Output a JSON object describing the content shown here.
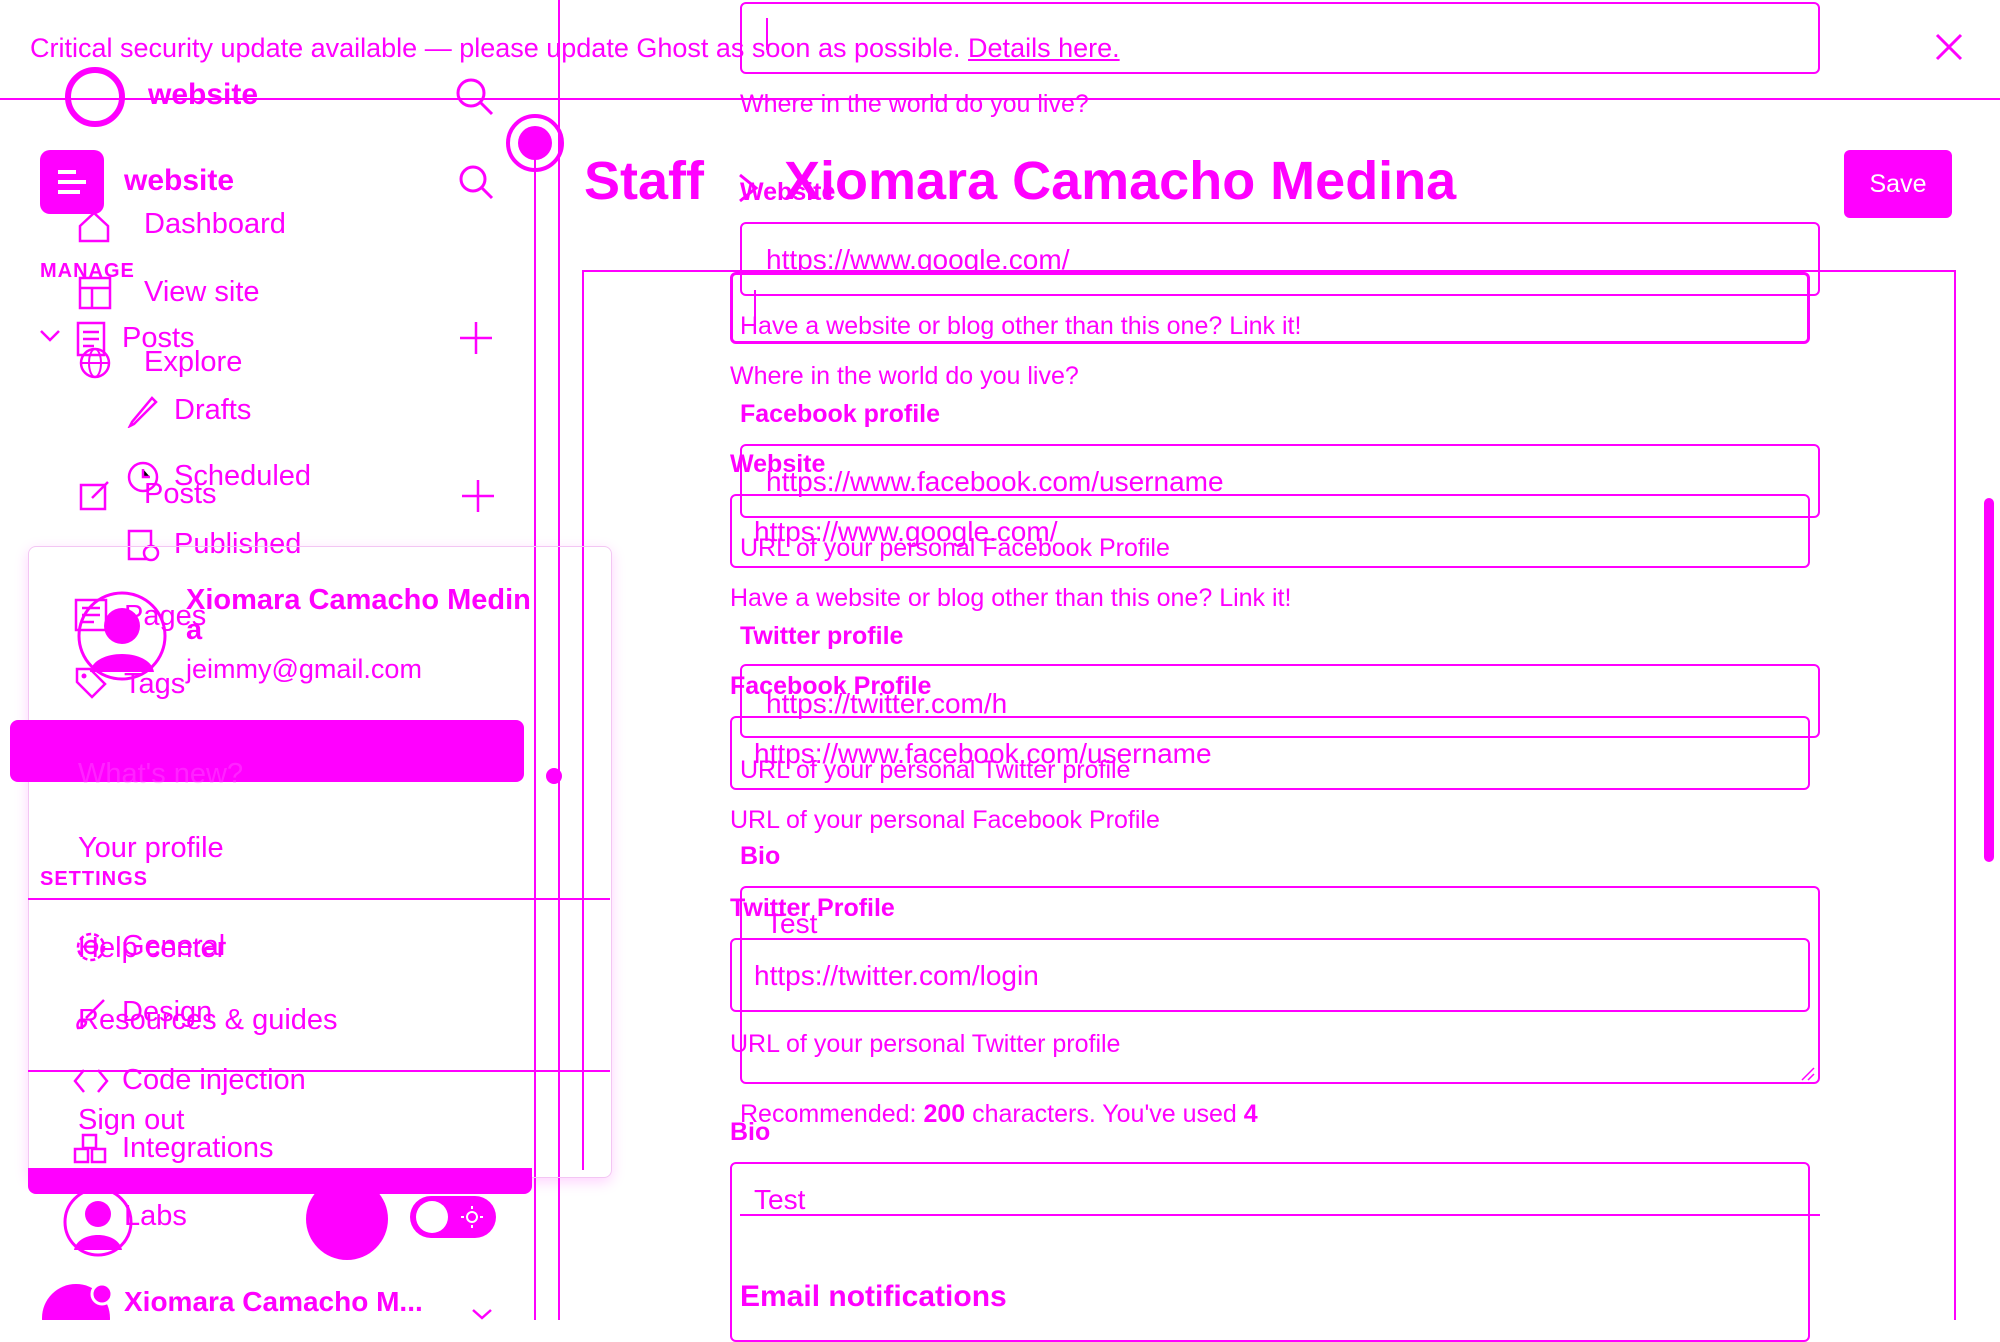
{
  "banner": {
    "message": "Critical security update available — please update Ghost as soon as possible.",
    "link": "Details here."
  },
  "site": {
    "name": "website"
  },
  "sidebar_top": {
    "site_name": "website",
    "items": [
      {
        "label": "Dashboard",
        "icon": "home-icon"
      },
      {
        "label": "View site",
        "icon": "layout-icon"
      },
      {
        "label": "Explore",
        "icon": "globe-icon"
      }
    ],
    "manage_heading": "MANAGE",
    "posts_label": "Posts",
    "posts_sub": [
      {
        "label": "Drafts",
        "icon": "pencil-icon"
      },
      {
        "label": "Scheduled",
        "icon": "clock-icon"
      },
      {
        "label": "Published",
        "icon": "published-icon"
      }
    ],
    "posts_label_2": "Posts",
    "pages_label": "Pages",
    "tags_label": "Tags",
    "settings_heading": "SETTINGS",
    "settings_items": [
      {
        "label": "General",
        "icon": "gear-icon"
      },
      {
        "label": "Design",
        "icon": "brush-icon"
      },
      {
        "label": "Code injection",
        "icon": "code-icon"
      },
      {
        "label": "Integrations",
        "icon": "integrations-icon"
      },
      {
        "label": "Labs",
        "icon": "flask-icon"
      }
    ]
  },
  "user_menu": {
    "name_line1": "Xiomara Camacho Medin",
    "name_line2": "a",
    "email": "jeimmy@gmail.com",
    "whats_new": "What's new?",
    "your_profile": "Your profile",
    "help_center": "Help center",
    "resources": "Resources & guides",
    "sign_out": "Sign out"
  },
  "footer_user": {
    "name": "Xiomara Camacho M..."
  },
  "header": {
    "breadcrumb_root": "Staff",
    "separator": ">",
    "title": "Xiomara Camacho Medina",
    "save": "Save"
  },
  "form_back": {
    "location_help": "Where in the world do you live?",
    "website_label": "Website",
    "website_value": "https://www.google.com/",
    "website_help": "Have a website or blog other than this one? Link it!",
    "facebook_label": "Facebook profile",
    "facebook_value": "https://www.facebook.com/username",
    "facebook_help": "URL of your personal Facebook Profile",
    "twitter_label": "Twitter profile",
    "twitter_value": "https://twitter.com/h",
    "twitter_help": "URL of your personal Twitter profile",
    "bio_label": "Bio",
    "bio_value": "Test",
    "bio_count_prefix": "Recommended: ",
    "bio_count_max": "200",
    "bio_count_mid": " characters. You've used ",
    "bio_count_used": "4",
    "email_notifications": "Email notifications"
  },
  "form_front": {
    "location_help": "Where in the world do you live?",
    "website_label": "Website",
    "website_value": "https://www.google.com/",
    "website_help": "Have a website or blog other than this one? Link it!",
    "facebook_label": "Facebook Profile",
    "facebook_value": "https://www.facebook.com/username",
    "facebook_help": "URL of your personal Facebook Profile",
    "twitter_label": "Twitter Profile",
    "twitter_value": "https://twitter.com/login",
    "twitter_help": "URL of your personal Twitter profile",
    "bio_label": "Bio",
    "bio_value": "Test"
  },
  "colors": {
    "accent": "#ff00ff",
    "background": "#ffffff"
  }
}
